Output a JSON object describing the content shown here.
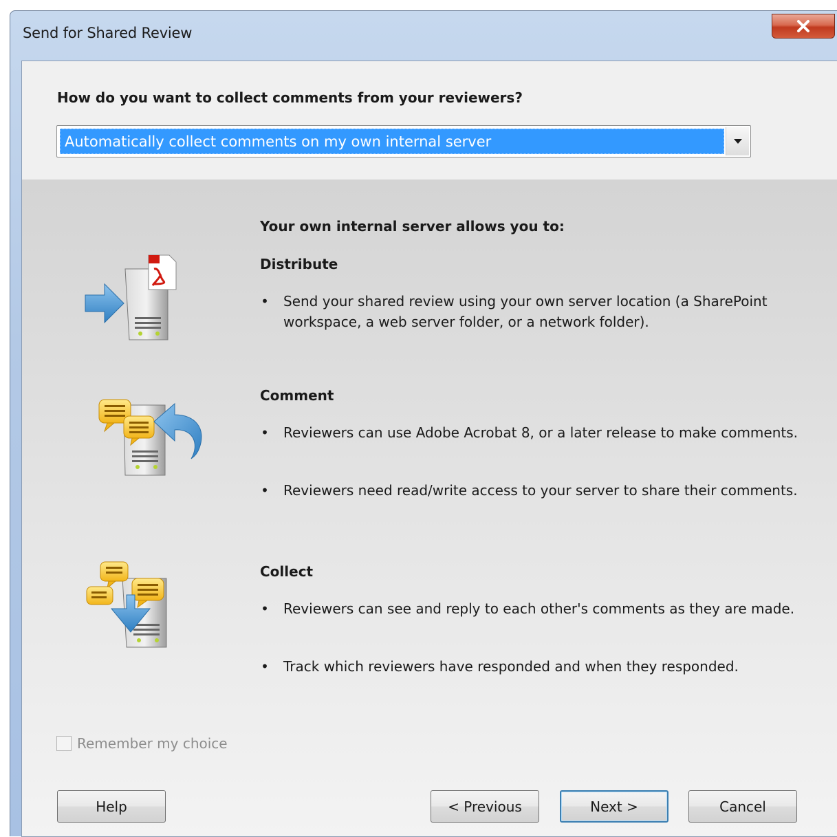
{
  "window": {
    "title": "Send for Shared Review"
  },
  "question": "How do you want to collect comments from your reviewers?",
  "collect_method": {
    "selected": "Automatically collect comments on my own internal server"
  },
  "panel": {
    "intro": "Your own internal server allows you to:",
    "sections": [
      {
        "heading": "Distribute",
        "icon": "server-distribute-icon",
        "bullets": [
          "Send your shared review using your own server location (a SharePoint workspace, a web server folder, or a network folder)."
        ]
      },
      {
        "heading": "Comment",
        "icon": "server-comment-icon",
        "bullets": [
          "Reviewers can use Adobe Acrobat 8, or a later release to make comments.",
          "Reviewers need read/write access to your server to share their comments."
        ]
      },
      {
        "heading": "Collect",
        "icon": "server-collect-icon",
        "bullets": [
          "Reviewers can see and reply to each other's comments as they are made.",
          "Track which reviewers have responded and when they responded."
        ]
      }
    ],
    "bullet_char": "•"
  },
  "remember": {
    "label": "Remember my choice",
    "checked": false,
    "enabled": false
  },
  "buttons": {
    "help": "Help",
    "previous": "< Previous",
    "next": "Next >",
    "cancel": "Cancel"
  },
  "colors": {
    "selection": "#3399ff",
    "title_bar": "#b3c9e6",
    "close": "#c0391e"
  }
}
